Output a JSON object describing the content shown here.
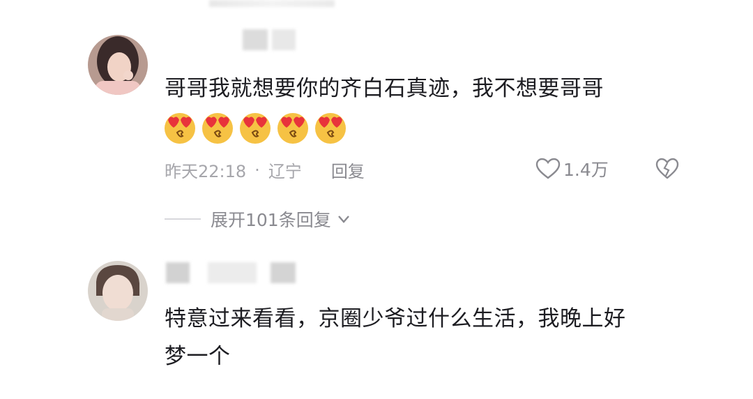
{
  "comments": [
    {
      "text_lines": [
        "哥哥我就想要你的齐白石真迹，我不想要哥哥"
      ],
      "emojis": [
        "heart-eyes-emoji",
        "heart-eyes-emoji",
        "heart-eyes-emoji",
        "heart-eyes-emoji",
        "heart-eyes-emoji"
      ],
      "time": "昨天22:18",
      "separator": "·",
      "location": "辽宁",
      "reply_label": "回复",
      "like_count": "1.4万",
      "expand_label": "展开101条回复"
    },
    {
      "text_lines": [
        "特意过来看看，京圈少爷过什么生活，我晚上好",
        "梦一个"
      ]
    }
  ],
  "icons": {
    "like": "heart-outline-icon",
    "dislike": "broken-heart-icon",
    "expand": "chevron-down-icon"
  },
  "colors": {
    "text": "#1d1d22",
    "meta": "#a6a6ab",
    "emoji_face": "#f6c244",
    "emoji_heart": "#e8333b"
  }
}
